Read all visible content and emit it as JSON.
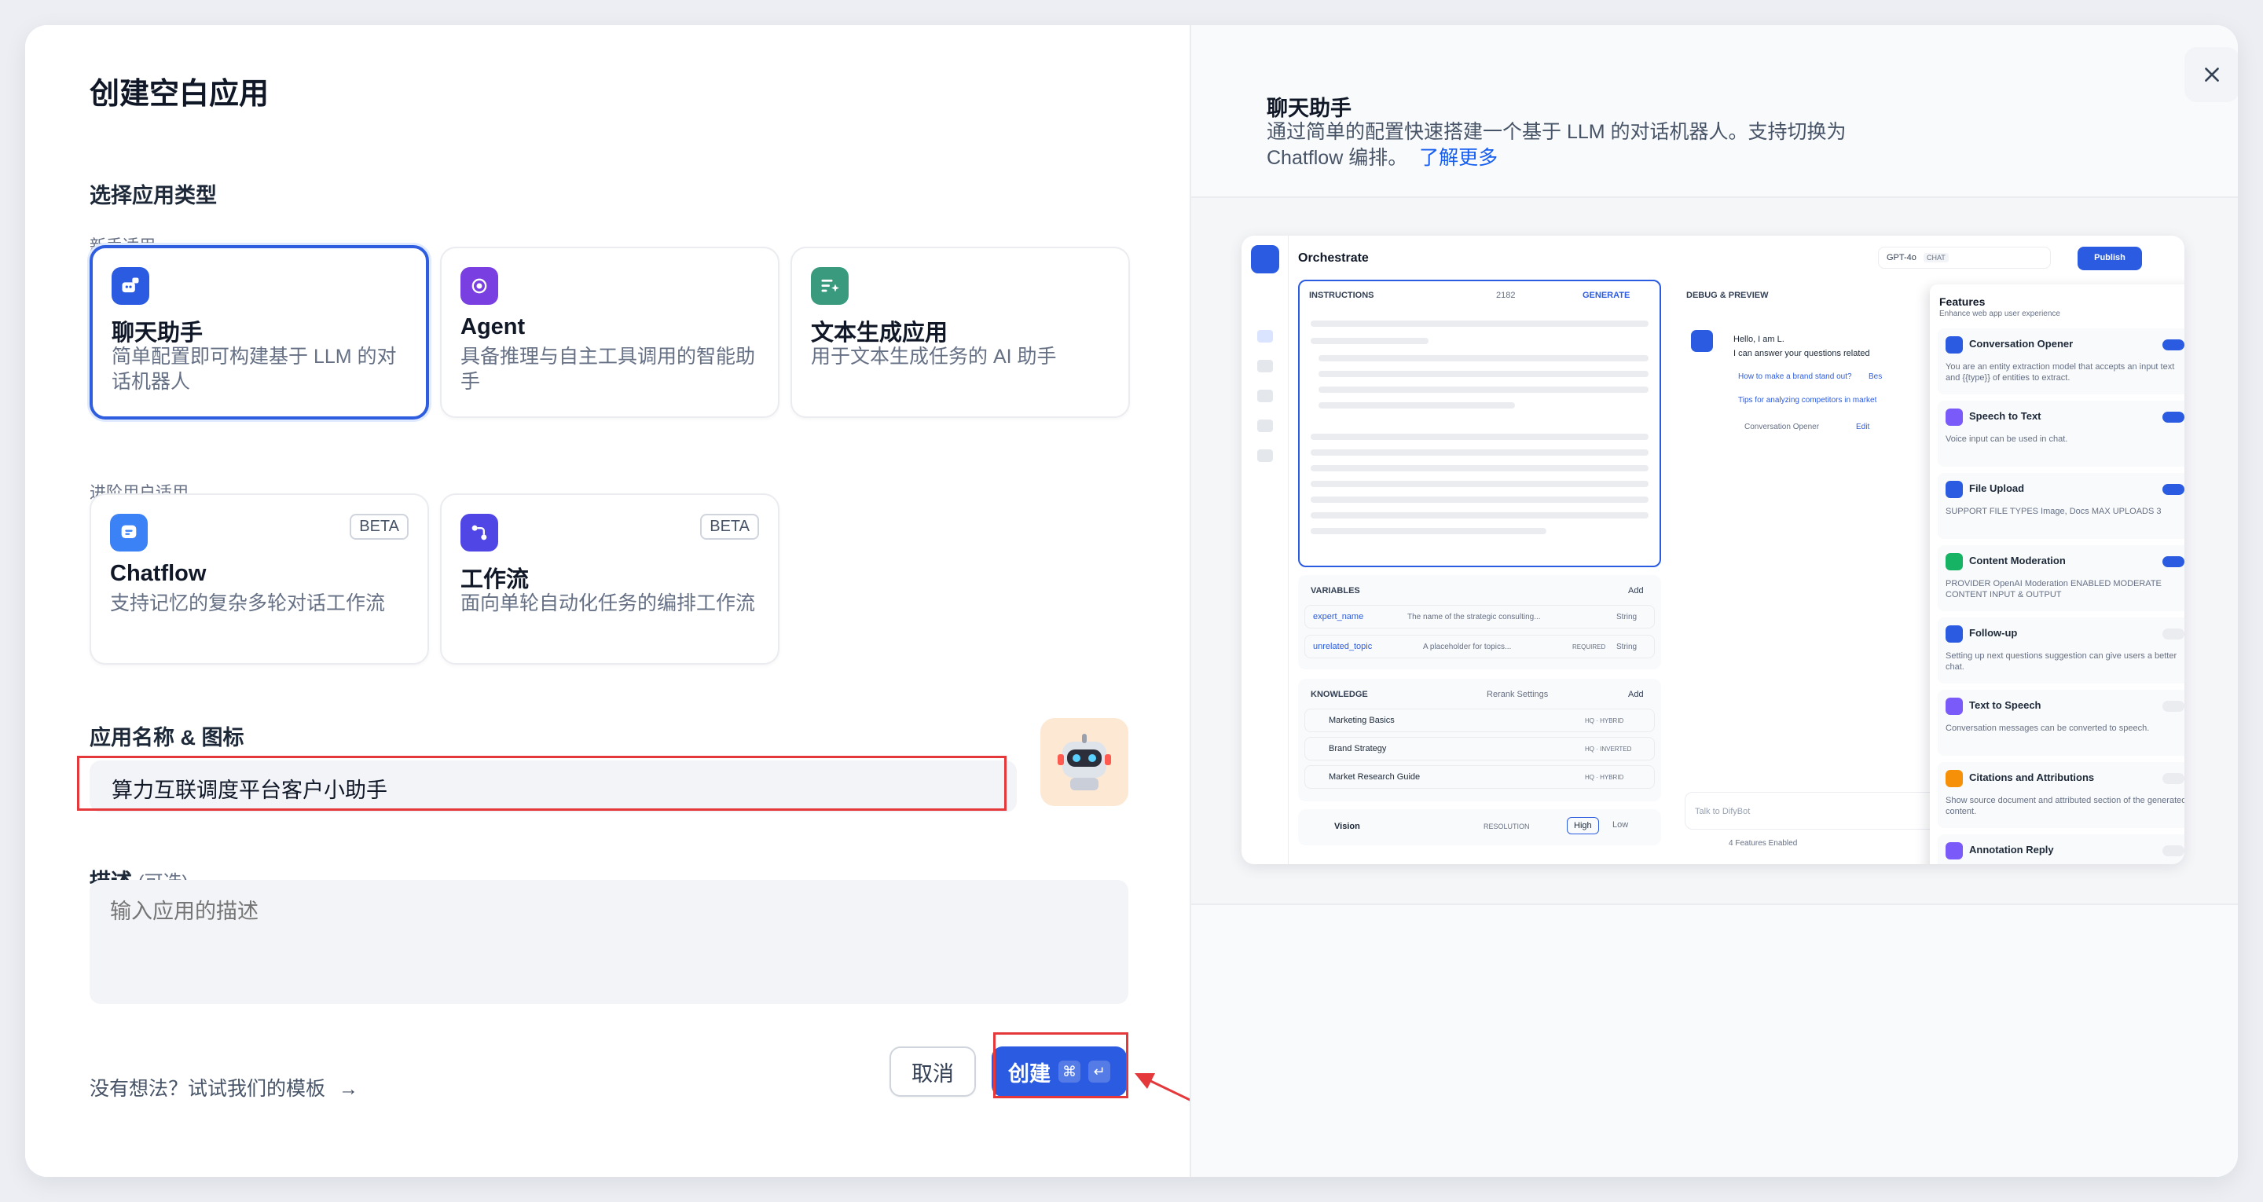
{
  "dialog": {
    "title": "创建空白应用",
    "section_type": "选择应用类型",
    "group_beginner": "新手适用",
    "group_advanced": "进阶用户适用",
    "cards": [
      {
        "title": "聊天助手",
        "desc": "简单配置即可构建基于 LLM 的对话机器人",
        "selected": true
      },
      {
        "title": "Agent",
        "desc": "具备推理与自主工具调用的智能助手"
      },
      {
        "title": "文本生成应用",
        "desc": "用于文本生成任务的 AI 助手"
      },
      {
        "title": "Chatflow",
        "desc": "支持记忆的复杂多轮对话工作流",
        "badge": "BETA"
      },
      {
        "title": "工作流",
        "desc": "面向单轮自动化任务的编排工作流",
        "badge": "BETA"
      }
    ],
    "name_label": "应用名称 & 图标",
    "name_value": "算力互联调度平台客户小助手",
    "desc_label": "描述",
    "desc_optional": "(可选)",
    "desc_placeholder": "输入应用的描述",
    "template_tip": "没有想法？试试我们的模板",
    "template_arrow": "→",
    "cancel": "取消",
    "create": "创建",
    "create_kbd1": "⌘",
    "create_kbd2": "↵"
  },
  "preview": {
    "title": "聊天助手",
    "desc": "通过简单的配置快速搭建一个基于 LLM 的对话机器人。支持切换为 Chatflow 编排。",
    "learn_more": "了解更多",
    "window": {
      "header": "Orchestrate",
      "model": "GPT-4o",
      "model_tag": "CHAT",
      "publish": "Publish",
      "instructions": "INSTRUCTIONS",
      "instr_count": "2182",
      "generate": "GENERATE",
      "variables": "VARIABLES",
      "add": "Add",
      "vars": [
        {
          "name": "expert_name",
          "desc": "The name of the strategic consulting...",
          "type": "String",
          "required": ""
        },
        {
          "name": "unrelated_topic",
          "desc": "A placeholder for topics...",
          "type": "String",
          "required": "REQUIRED"
        }
      ],
      "knowledge": "KNOWLEDGE",
      "rerank": "Rerank Settings",
      "docs": [
        {
          "name": "Marketing Basics",
          "tag": "HQ · HYBRID"
        },
        {
          "name": "Brand Strategy",
          "tag": "HQ · INVERTED"
        },
        {
          "name": "Market Research Guide",
          "tag": "HQ · HYBRID"
        }
      ],
      "vision": "Vision",
      "resolution": "RESOLUTION",
      "high": "High",
      "low": "Low",
      "debug": "DEBUG & PREVIEW",
      "bot_msg1": "Hello, I am L.",
      "bot_msg2": "I can answer your questions related",
      "sugg1": "How to make a brand stand out?",
      "sugg1b": "Bes",
      "sugg2": "Tips for analyzing competitors in market",
      "opener": "Conversation Opener",
      "edit": "Edit",
      "chat_placeholder": "Talk to DifyBot",
      "features_enabled": "4 Features Enabled",
      "features_title": "Features",
      "features_sub": "Enhance web app user experience",
      "features": [
        {
          "title": "Conversation Opener",
          "desc": "You are an entity extraction model that accepts an input text and {{type}} of entities to extract.",
          "on": true,
          "color": "#2b5be0"
        },
        {
          "title": "Speech to Text",
          "desc": "Voice input can be used in chat.",
          "on": true,
          "color": "#7a5af8"
        },
        {
          "title": "File Upload",
          "desc": "SUPPORT FILE TYPES  Image, Docs     MAX UPLOADS  3",
          "on": true,
          "color": "#2b5be0"
        },
        {
          "title": "Content Moderation",
          "desc": "PROVIDER  OpenAI Moderation     ENABLED MODERATE CONTENT  INPUT & OUTPUT",
          "on": true,
          "color": "#16b364"
        },
        {
          "title": "Follow-up",
          "desc": "Setting up next questions suggestion can give users a better chat.",
          "on": false,
          "color": "#2b5be0"
        },
        {
          "title": "Text to Speech",
          "desc": "Conversation messages can be converted to speech.",
          "on": false,
          "color": "#7a5af8"
        },
        {
          "title": "Citations and Attributions",
          "desc": "Show source document and attributed section of the generated content.",
          "on": false,
          "color": "#f79009"
        },
        {
          "title": "Annotation Reply",
          "desc": "",
          "on": false,
          "color": "#7a5af8"
        }
      ]
    }
  },
  "colors": {
    "primary": "#2b5be0",
    "highlight": "#e5383b"
  }
}
